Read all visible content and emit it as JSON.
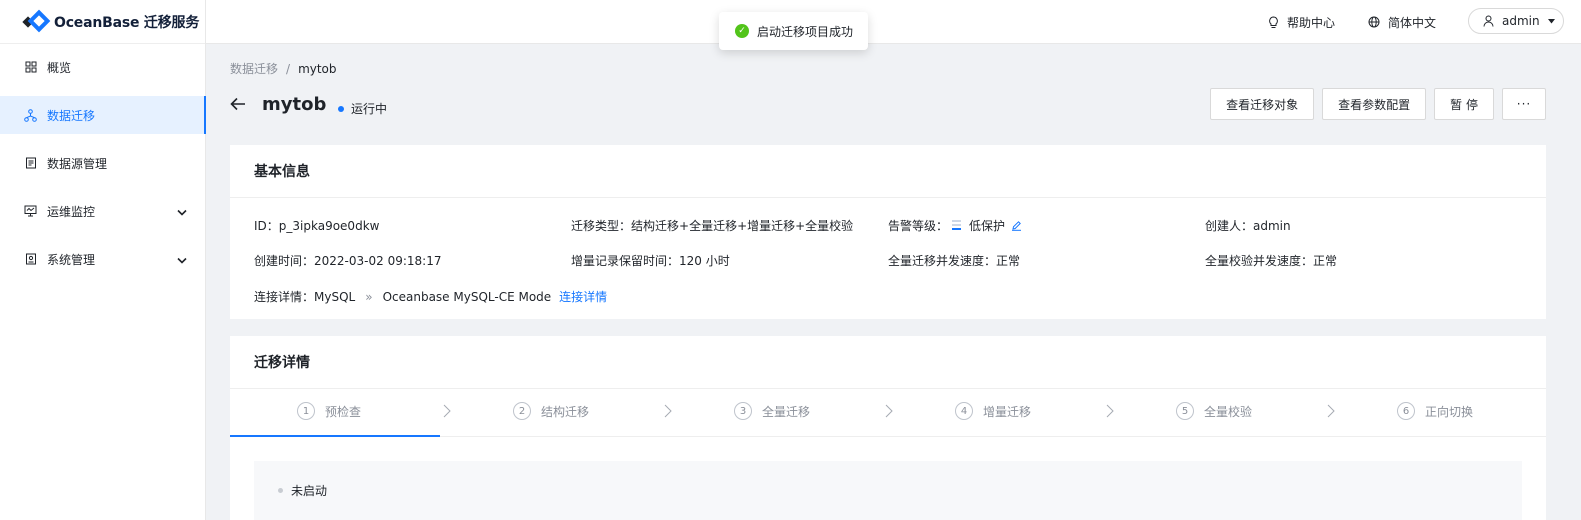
{
  "app": {
    "name": "OceanBase 迁移服务"
  },
  "sidebar": {
    "items": [
      {
        "label": "概览",
        "icon": "grid-icon"
      },
      {
        "label": "数据迁移",
        "icon": "flow-icon",
        "active": true
      },
      {
        "label": "数据源管理",
        "icon": "database-icon"
      },
      {
        "label": "运维监控",
        "icon": "monitor-icon",
        "expandable": true
      },
      {
        "label": "系统管理",
        "icon": "settings-icon",
        "expandable": true
      }
    ]
  },
  "topbar": {
    "help": "帮助中心",
    "language": "简体中文",
    "user": "admin"
  },
  "toast": {
    "message": "启动迁移项目成功"
  },
  "breadcrumb": {
    "parent": "数据迁移",
    "separator": "/",
    "current": "mytob"
  },
  "project": {
    "title": "mytob",
    "status": "运行中",
    "status_color": "#1677ff"
  },
  "actions": {
    "view_objects": "查看迁移对象",
    "view_params": "查看参数配置",
    "pause": "暂 停",
    "more": "···"
  },
  "basic_info": {
    "heading": "基本信息",
    "id_label": "ID：",
    "id_value": "p_3ipka9oe0dkw",
    "type_label": "迁移类型：",
    "type_value": "结构迁移+全量迁移+增量迁移+全量校验",
    "alarm_label": "告警等级：",
    "alarm_value": "低保护",
    "creator_label": "创建人：",
    "creator_value": "admin",
    "created_label": "创建时间：",
    "created_value": "2022-03-02 09:18:17",
    "retention_label": "增量记录保留时间：",
    "retention_value": "120 小时",
    "full_speed_label": "全量迁移并发速度：",
    "full_speed_value": "正常",
    "verify_speed_label": "全量校验并发速度：",
    "verify_speed_value": "正常",
    "conn_label": "连接详情：",
    "conn_source": "MySQL",
    "conn_arrow": "»",
    "conn_target": "Oceanbase MySQL-CE Mode",
    "conn_link": "连接详情"
  },
  "migration": {
    "heading": "迁移详情",
    "steps": [
      {
        "num": "1",
        "label": "预检查"
      },
      {
        "num": "2",
        "label": "结构迁移"
      },
      {
        "num": "3",
        "label": "全量迁移"
      },
      {
        "num": "4",
        "label": "增量迁移"
      },
      {
        "num": "5",
        "label": "全量校验"
      },
      {
        "num": "6",
        "label": "正向切换"
      }
    ],
    "panel_status": "未启动"
  },
  "colors": {
    "accent": "#1677ff",
    "success": "#52c41a"
  }
}
